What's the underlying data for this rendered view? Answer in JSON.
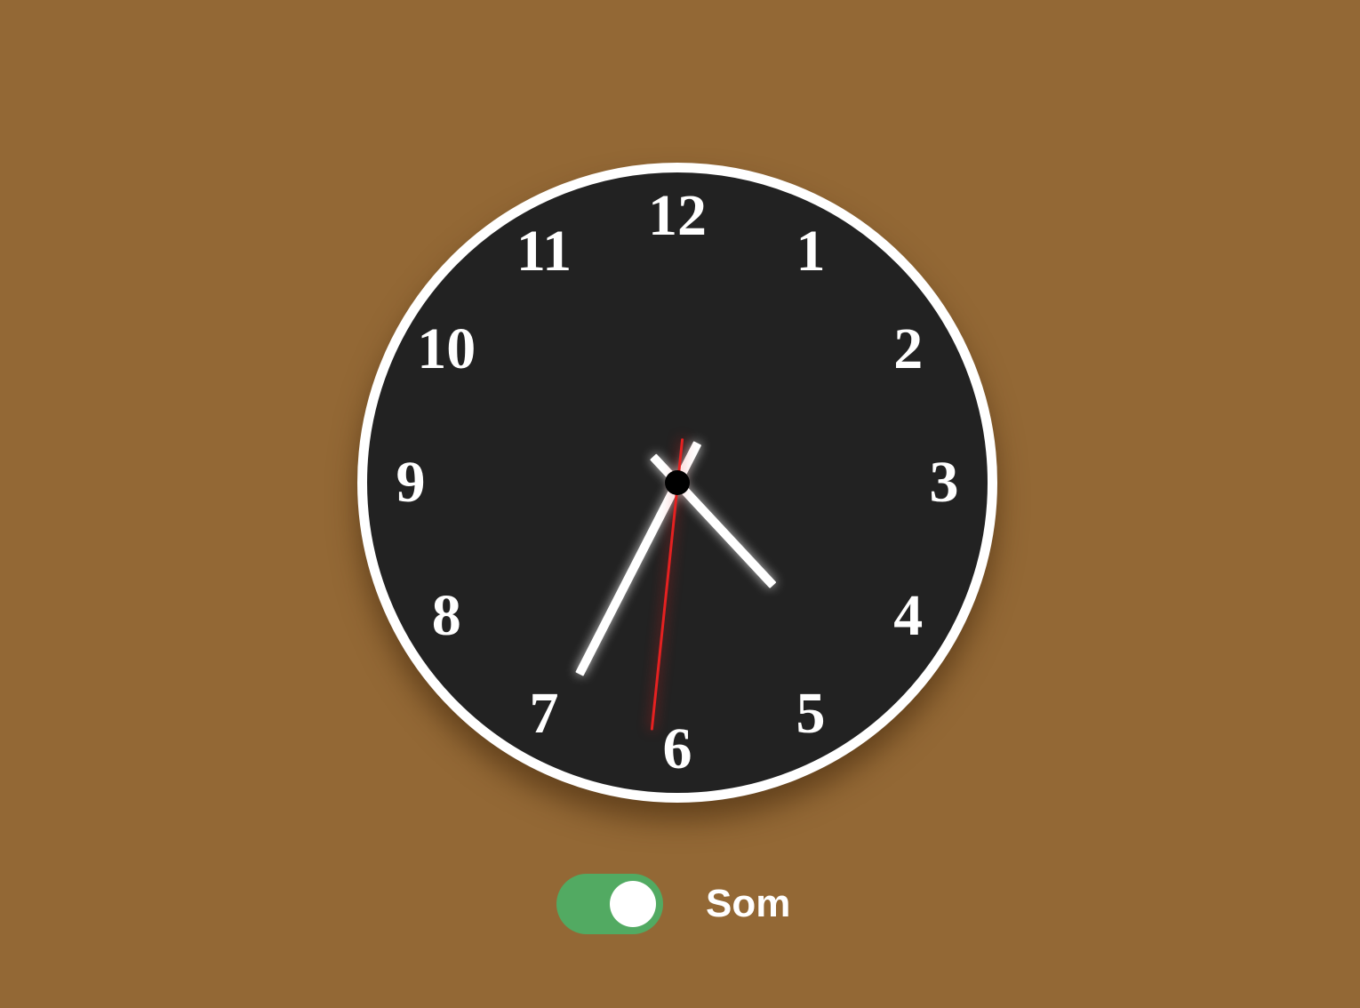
{
  "clock": {
    "numerals": [
      "12",
      "1",
      "2",
      "3",
      "4",
      "5",
      "6",
      "7",
      "8",
      "9",
      "10",
      "11"
    ],
    "time": {
      "hour": 4,
      "minute": 34,
      "second": 31
    },
    "colors": {
      "background": "#936835",
      "face": "#222222",
      "rim": "#ffffff",
      "hands": "#ffffff",
      "second_hand": "#e52121",
      "center": "#000000"
    }
  },
  "sound_toggle": {
    "label": "Som",
    "checked": true,
    "color_on": "#52aa62"
  }
}
